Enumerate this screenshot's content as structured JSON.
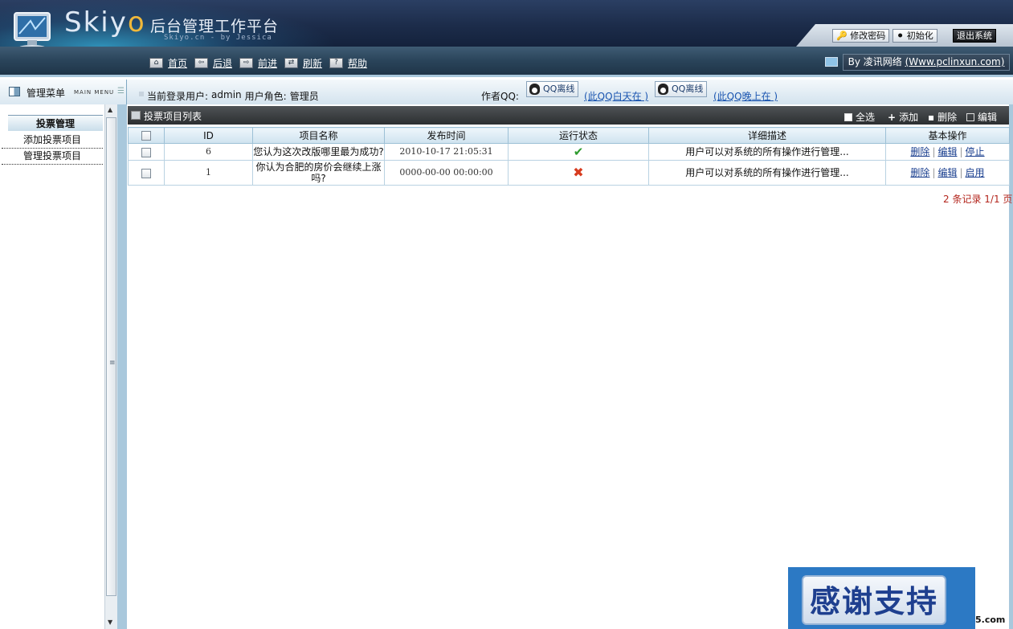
{
  "header": {
    "logo_main": "Skiyo",
    "platform_title": "后台管理工作平台",
    "logo_sub": "Skiyo.cn - by Jessica",
    "buttons": {
      "change_password": "修改密码",
      "init": "初始化",
      "logout": "退出系统"
    }
  },
  "nav": {
    "items": [
      {
        "label": "首页",
        "icon": "home-icon"
      },
      {
        "label": "后退",
        "icon": "back-arrow-icon"
      },
      {
        "label": "前进",
        "icon": "forward-arrow-icon"
      },
      {
        "label": "刷新",
        "icon": "refresh-icon"
      },
      {
        "label": "帮助",
        "icon": "help-icon"
      }
    ],
    "by_prefix": "By 凌讯网络",
    "by_link": "(Www.pclinxun.com)"
  },
  "info": {
    "menu_title": "管理菜单",
    "menu_sub": "MAIN MENU",
    "current_user_label": "当前登录用户:",
    "current_user": "admin",
    "role_label": "用户角色:",
    "role": "管理员",
    "qq_label": "作者QQ:",
    "qq_badge": "QQ离线",
    "qq_day": "(此QQ白天在 )",
    "qq_night": "(此QQ晚上在 )"
  },
  "sidebar": {
    "group": "投票管理",
    "items": [
      "添加投票项目",
      "管理投票项目"
    ]
  },
  "panel": {
    "title": "投票项目列表",
    "actions": {
      "select_all": "全选",
      "add": "添加",
      "delete": "删除",
      "edit": "编辑"
    }
  },
  "table": {
    "headers": [
      "ID",
      "项目名称",
      "发布时间",
      "运行状态",
      "详细描述",
      "基本操作"
    ],
    "rows": [
      {
        "id": "6",
        "name": "您认为这次改版哪里最为成功?",
        "time": "2010-10-17 21:05:31",
        "status": "running",
        "desc": "用户可以对系统的所有操作进行管理...",
        "ops": [
          "删除",
          "编辑",
          "停止"
        ]
      },
      {
        "id": "1",
        "name": "你认为合肥的房价会继续上涨吗?",
        "time": "0000-00-00 00:00:00",
        "status": "stopped",
        "desc": "用户可以对系统的所有操作进行管理...",
        "ops": [
          "删除",
          "编辑",
          "启用"
        ]
      }
    ]
  },
  "records": "2 条记录 1/1 页",
  "promo": "感谢支持",
  "watermark": "5.com",
  "colors": {
    "header_dark": "#1c2c4a",
    "accent_blue": "#a9c8dc",
    "ok_green": "#2d9b2d",
    "stop_red": "#d73b1f",
    "records_red": "#b3251c"
  }
}
